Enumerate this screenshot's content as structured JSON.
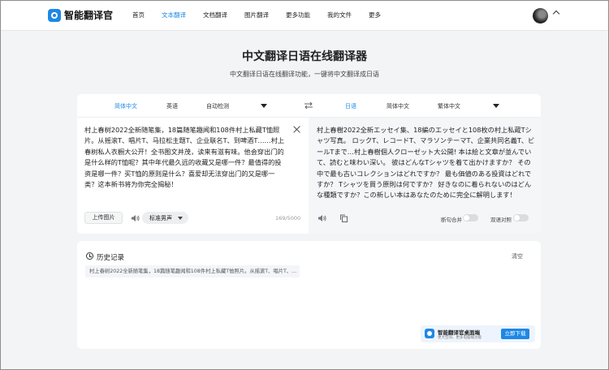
{
  "colors": {
    "accent": "#1e88e5",
    "background": "#f3f4f6",
    "panel": "#ffffff",
    "target_panel": "#f5f6f7"
  },
  "app": {
    "name": "智能翻译官",
    "logo_icon": "app-logo-icon"
  },
  "nav": {
    "items": [
      {
        "label": "首页"
      },
      {
        "label": "文本翻译"
      },
      {
        "label": "文档翻译"
      },
      {
        "label": "图片翻译"
      },
      {
        "label": "更多功能"
      },
      {
        "label": "我的文件"
      },
      {
        "label": "更多"
      }
    ],
    "active": "文本翻译"
  },
  "page": {
    "title": "中文翻译日语在线翻译器",
    "subtitle": "中文翻译日语在线翻译功能，一键将中文翻译成日语"
  },
  "languages": {
    "source": {
      "selected": "简体中文",
      "options": [
        "英语",
        "自动检测"
      ]
    },
    "target": {
      "selected": "日语",
      "options": [
        "简体中文",
        "繁体中文"
      ]
    }
  },
  "source": {
    "text": "村上春树2022全新随笔集，18篇随笔趣闻和108件村上私藏T恤照片。从摇滚T、唱片T、马拉松主题T、企业联名T、到啤酒T……村上春树私人衣橱大公开！全书图文并茂，读来有滋有味。他会穿出门的是什么样的T恤呢？其中年代最久远的收藏又是哪一件？最值得的投资是哪一件？买T恤的原则是什么？喜爱却无法穿出门的又是哪一类？这本新书将为你完全揭秘！",
    "upload_label": "上传图片",
    "voice_label": "标准男声",
    "char_count": "169/5000"
  },
  "target": {
    "text": "村上春樹2022全新エッセイ集、18編のエッセイと108枚の村上私蔵Tシャツ写真。 ロックT、レコードT、マラソンテーマT、企業共同名義T、ビールTまで…村上春樹個人クローゼット大公開! 本は絵と文章が並んでいて、読むと味わい深い。 彼はどんなTシャツを着て出かけますか？ その中で最も古いコレクションはどれですか？ 最も価値のある投資はどれですか？ Tシャツを買う原則は何ですか？ 好きなのに着られないのはどんな種類ですか？この新しい本はあなたのために完全に解明します！",
    "merge_label": "断句合并",
    "bilingual_label": "双语对照"
  },
  "history": {
    "title": "历史记录",
    "clear_label": "清空",
    "entries": [
      {
        "text": "村上春树2022全新随笔集，18篇随笔趣闻和108件村上私藏T恤照片。从摇滚T、唱片T、..."
      }
    ]
  },
  "promo": {
    "title": "智能翻译官桌面端",
    "subtitle": "更大空间、更多电脑端功能",
    "button_label": "立即下载"
  }
}
